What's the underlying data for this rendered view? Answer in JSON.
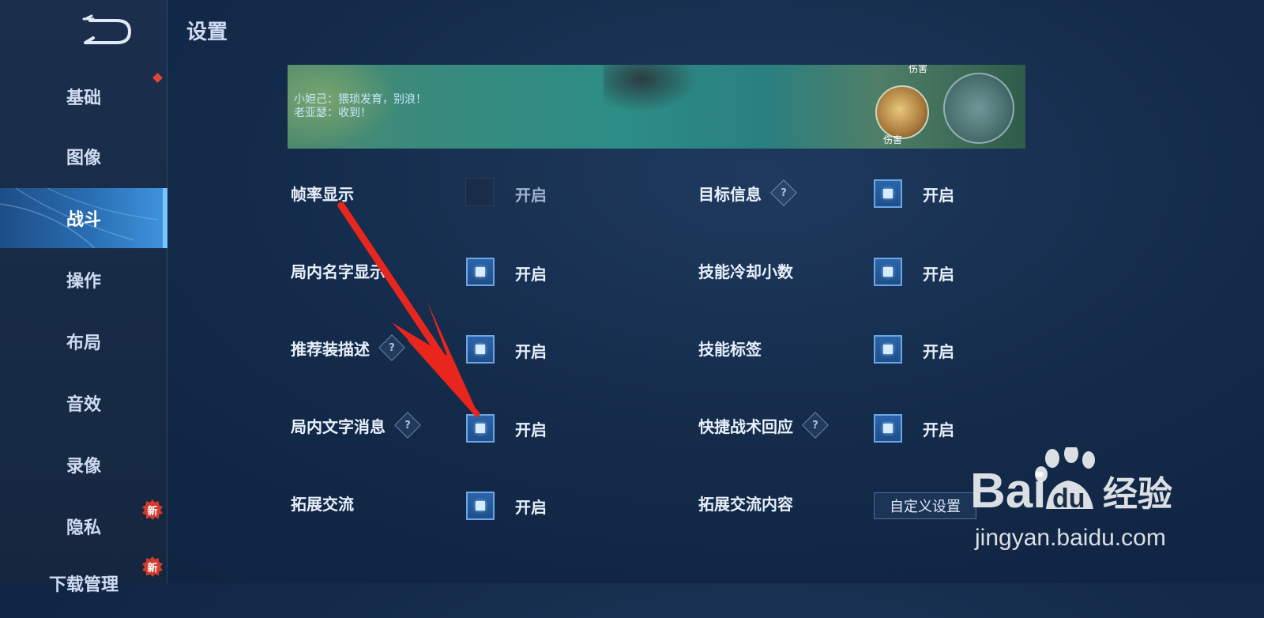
{
  "header": {
    "title": "设置"
  },
  "sidebar": {
    "items": [
      {
        "label": "基础",
        "badge": "dot"
      },
      {
        "label": "图像"
      },
      {
        "label": "战斗",
        "active": true
      },
      {
        "label": "操作"
      },
      {
        "label": "布局"
      },
      {
        "label": "音效"
      },
      {
        "label": "录像"
      },
      {
        "label": "隐私",
        "badge": "新"
      },
      {
        "label": "下载管理",
        "badge": "新"
      }
    ]
  },
  "preview": {
    "chat_line_1": "小妲己：猥琐发育，别浪！",
    "chat_line_2": "老亚瑟：收到！",
    "skill_label": "伤害",
    "skill_label_top": "伤害"
  },
  "settings": {
    "left": [
      {
        "label": "帧率显示",
        "help": false,
        "checked": false,
        "state": "开启"
      },
      {
        "label": "局内名字显示",
        "help": false,
        "checked": true,
        "state": "开启"
      },
      {
        "label": "推荐装描述",
        "help": true,
        "checked": true,
        "state": "开启"
      },
      {
        "label": "局内文字消息",
        "help": true,
        "checked": true,
        "state": "开启"
      },
      {
        "label": "拓展交流",
        "help": false,
        "checked": true,
        "state": "开启"
      }
    ],
    "right": [
      {
        "label": "目标信息",
        "help": true,
        "checked": true,
        "state": "开启"
      },
      {
        "label": "技能冷却小数",
        "help": false,
        "checked": true,
        "state": "开启"
      },
      {
        "label": "技能标签",
        "help": false,
        "checked": true,
        "state": "开启"
      },
      {
        "label": "快捷战术回应",
        "help": true,
        "checked": true,
        "state": "开启"
      },
      {
        "label": "拓展交流内容",
        "help": false,
        "button": "自定义设置"
      }
    ],
    "help_glyph": "?"
  },
  "watermark": {
    "brand_text": "Bai",
    "brand_du": "du",
    "brand_cn": "经验",
    "url": "jingyan.baidu.com"
  },
  "colors": {
    "accent": "#3f94df",
    "annotation_arrow": "#e8261e",
    "badge_red": "#d33b2f"
  }
}
